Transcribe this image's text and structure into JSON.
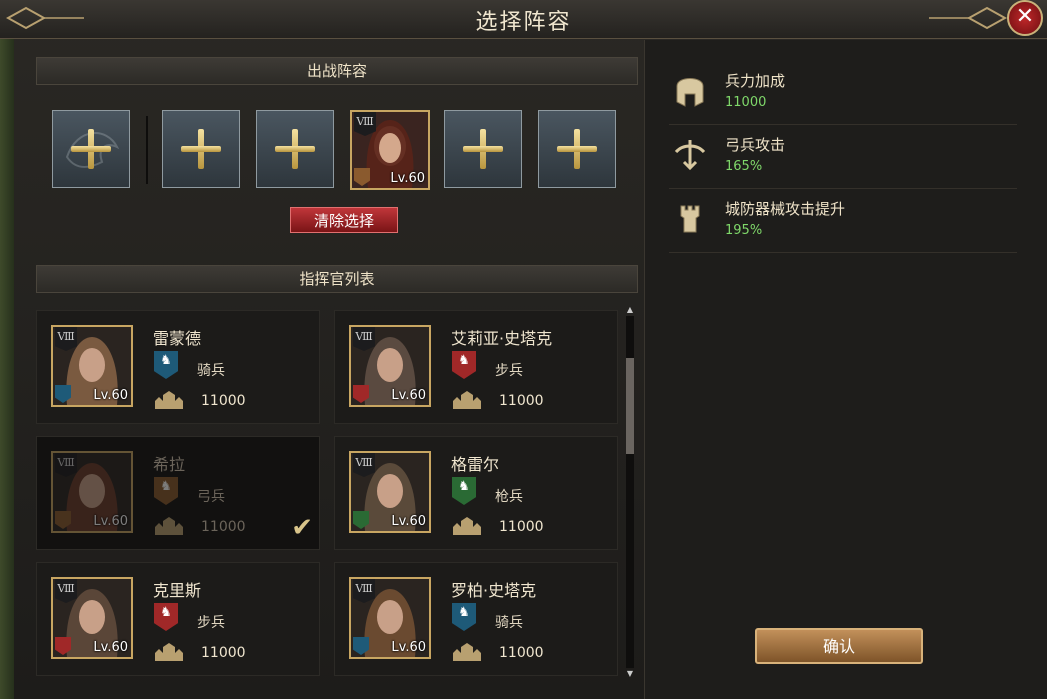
{
  "window": {
    "title": "选择阵容",
    "close_label": "✕"
  },
  "lineup": {
    "header": "出战阵容",
    "clear_button": "清除选择",
    "selected": {
      "rank": "Ⅷ",
      "level": "Lv.60",
      "type_color": "#8a5a2e"
    }
  },
  "commanders": {
    "header": "指挥官列表",
    "items": [
      {
        "name": "雷蒙德",
        "rank": "Ⅷ",
        "level": "Lv.60",
        "troop": "骑兵",
        "troop_color": "#1e5a78",
        "power": "11000",
        "portrait_color": "#7a5a40"
      },
      {
        "name": "艾莉亚·史塔克",
        "rank": "Ⅷ",
        "level": "Lv.60",
        "troop": "步兵",
        "troop_color": "#a02828",
        "power": "11000",
        "portrait_color": "#5a4a40"
      },
      {
        "name": "希拉",
        "rank": "Ⅷ",
        "level": "Lv.60",
        "troop": "弓兵",
        "troop_color": "#8a5a2e",
        "power": "11000",
        "portrait_color": "#6a3a2a",
        "selected": true
      },
      {
        "name": "格雷尔",
        "rank": "Ⅷ",
        "level": "Lv.60",
        "troop": "枪兵",
        "troop_color": "#2a6a34",
        "power": "11000",
        "portrait_color": "#5a4a3a"
      },
      {
        "name": "克里斯",
        "rank": "Ⅷ",
        "level": "Lv.60",
        "troop": "步兵",
        "troop_color": "#a02828",
        "power": "11000",
        "portrait_color": "#5a4638"
      },
      {
        "name": "罗柏·史塔克",
        "rank": "Ⅷ",
        "level": "Lv.60",
        "troop": "骑兵",
        "troop_color": "#1e5a78",
        "power": "11000",
        "portrait_color": "#6a4a30"
      }
    ]
  },
  "bonuses": [
    {
      "label": "兵力加成",
      "value": "11000",
      "icon": "helmet-icon"
    },
    {
      "label": "弓兵攻击",
      "value": "165%",
      "icon": "crossbow-icon"
    },
    {
      "label": "城防器械攻击提升",
      "value": "195%",
      "icon": "tower-icon"
    }
  ],
  "confirm_button": "确认",
  "colors": {
    "accent_gold": "#c8a662",
    "bonus_green": "#7fd86a",
    "clear_red": "#c0363a"
  }
}
